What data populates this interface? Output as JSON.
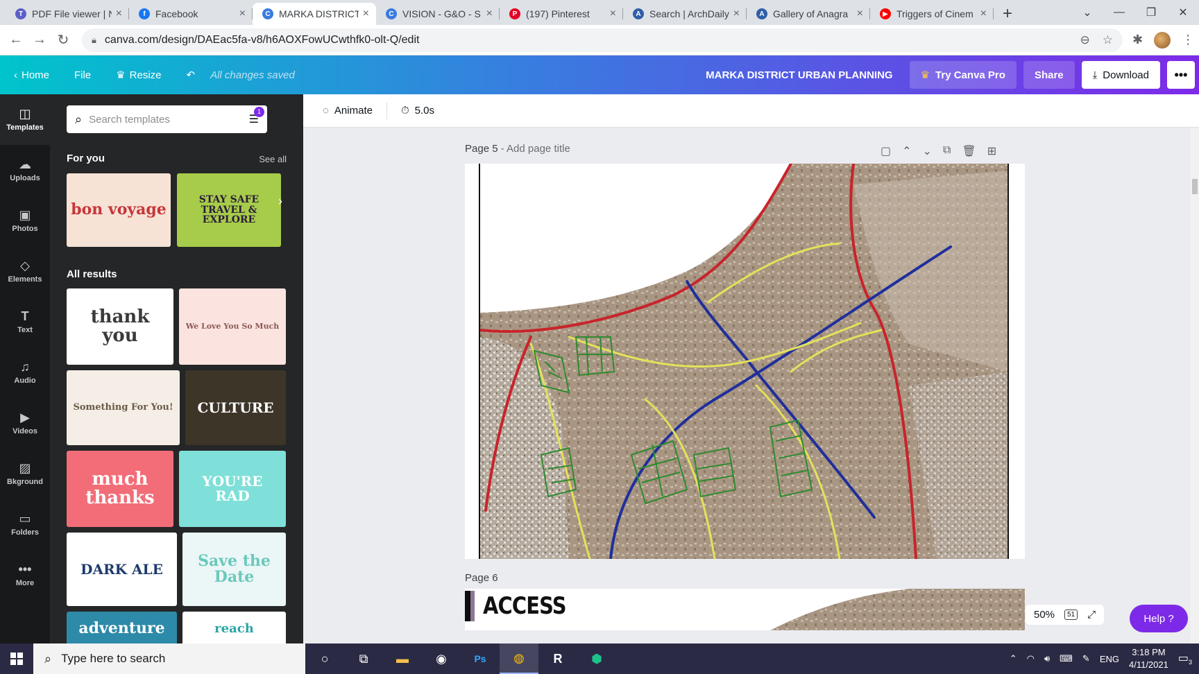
{
  "tabs": [
    {
      "title": "PDF File viewer | N",
      "favicon_color": "#5b5fc7",
      "favicon": "T"
    },
    {
      "title": "Facebook",
      "favicon_color": "#1877f2",
      "favicon": "f"
    },
    {
      "title": "MARKA DISTRICT",
      "favicon_color": "#3a7be0",
      "favicon": "C",
      "active": true
    },
    {
      "title": "VISION - G&O - S",
      "favicon_color": "#3a7be0",
      "favicon": "C"
    },
    {
      "title": "(197) Pinterest",
      "favicon_color": "#e60023",
      "favicon": "P"
    },
    {
      "title": "Search | ArchDaily",
      "favicon_color": "#2f5fa7",
      "favicon": "A"
    },
    {
      "title": "Gallery of Anagra",
      "favicon_color": "#2f5fa7",
      "favicon": "A"
    },
    {
      "title": "Triggers of Cinem",
      "favicon_color": "#ff0000",
      "favicon": "▶"
    }
  ],
  "address": {
    "url": "canva.com/design/DAEac5fa-v8/h6AOXFowUCwthfk0-olt-Q/edit"
  },
  "header": {
    "home": "Home",
    "file": "File",
    "resize": "Resize",
    "saved": "All changes saved",
    "design_title": "MARKA DISTRICT URBAN PLANNING",
    "try_pro": "Try Canva Pro",
    "share": "Share",
    "download": "Download"
  },
  "rail": [
    {
      "label": "Templates",
      "icon": "templates-icon",
      "glyph": "◫"
    },
    {
      "label": "Uploads",
      "icon": "upload-cloud-icon",
      "glyph": "☁"
    },
    {
      "label": "Photos",
      "icon": "photo-icon",
      "glyph": "▣"
    },
    {
      "label": "Elements",
      "icon": "shapes-icon",
      "glyph": "◇"
    },
    {
      "label": "Text",
      "icon": "text-icon",
      "glyph": "T"
    },
    {
      "label": "Audio",
      "icon": "music-note-icon",
      "glyph": "♫"
    },
    {
      "label": "Videos",
      "icon": "video-icon",
      "glyph": "▶"
    },
    {
      "label": "Bkground",
      "icon": "background-icon",
      "glyph": "▨"
    },
    {
      "label": "Folders",
      "icon": "folder-icon",
      "glyph": "▭"
    },
    {
      "label": "More",
      "icon": "more-dots-icon",
      "glyph": "•••"
    }
  ],
  "panel": {
    "search_placeholder": "Search templates",
    "filter_badge": "1",
    "for_you": "For you",
    "see_all": "See all",
    "all_results": "All results",
    "featured": [
      {
        "text": "bon voyage",
        "bg": "#f6e3d6",
        "fg": "#c7363a"
      },
      {
        "text": "STAY SAFE  TRAVEL & EXPLORE",
        "bg": "#a7cc4a",
        "fg": "#2b1b3a"
      }
    ],
    "results": [
      {
        "text": "thank you",
        "bg": "#ffffff",
        "fg": "#3a3a3a"
      },
      {
        "text": "We Love You So Much",
        "bg": "#fbe3df",
        "fg": "#8a5a55"
      },
      {
        "text": "Something For You!",
        "bg": "#f4eee6",
        "fg": "#6b5a46"
      },
      {
        "text": "CULTURE",
        "bg": "#3d3528",
        "fg": "#ffffff"
      },
      {
        "text": "much thanks",
        "bg": "#f26d78",
        "fg": "#ffffff"
      },
      {
        "text": "YOU'RE RAD",
        "bg": "#7ee0d8",
        "fg": "#ffffff"
      },
      {
        "text": "DARK ALE",
        "bg": "#ffffff",
        "fg": "#1d3b6b"
      },
      {
        "text": "Save the Date",
        "bg": "#eaf7f6",
        "fg": "#6cc8bd"
      },
      {
        "text": "adventure",
        "bg": "#2d8aa8",
        "fg": "#ffffff"
      },
      {
        "text": "reach",
        "bg": "#ffffff",
        "fg": "#2ba5a8"
      }
    ]
  },
  "editor": {
    "animate": "Animate",
    "duration": "5.0s",
    "page5_label": "Page 5",
    "page5_subtitle": " - Add page title",
    "page6_label": "Page 6",
    "page6_heading": "ACCESS",
    "zoom": "50%",
    "page_count": "51",
    "help": "Help ?"
  },
  "map": {
    "legend_colors": {
      "highway": "#c8242b",
      "arterial": "#1f2f9b",
      "collector": "#e3e25a",
      "local": "#2e8b2e"
    }
  },
  "taskbar": {
    "search_placeholder": "Type here to search",
    "lang": "ENG",
    "time": "3:18 PM",
    "date": "4/11/2021",
    "notifications": "3"
  }
}
